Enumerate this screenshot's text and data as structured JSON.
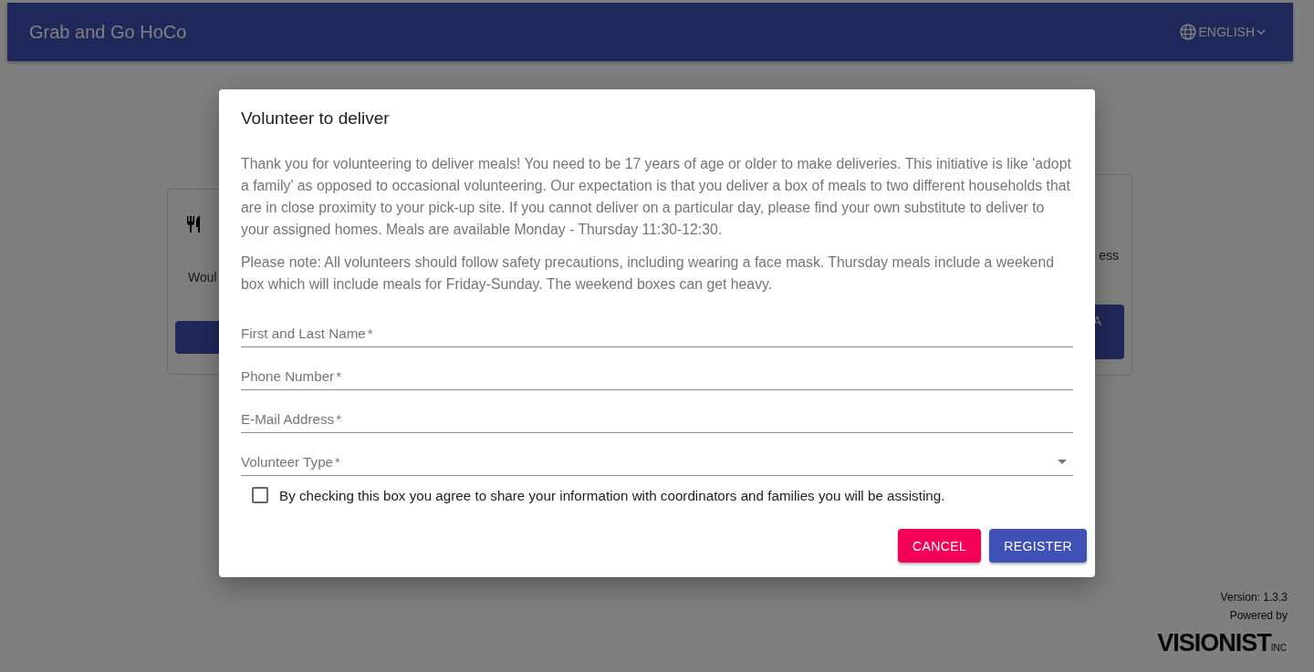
{
  "app_bar": {
    "title": "Grab and Go HoCo",
    "language": "ENGLISH"
  },
  "background": {
    "left_card": {
      "text": "Woul"
    },
    "right_card": {
      "text": "ess",
      "button": "A"
    }
  },
  "dialog": {
    "title": "Volunteer to deliver",
    "paragraphs": [
      "Thank you for volunteering to deliver meals! You need to be 17 years of age or older to make deliveries. This initiative is like 'adopt a family' as opposed to occasional volunteering. Our expectation is that you deliver a box of meals to two different households that are in close proximity to your pick-up site. If you cannot deliver on a particular day, please find your own substitute to deliver to your assigned homes. Meals are available Monday - Thursday 11:30-12:30.",
      "Please note: All volunteers should follow safety precautions, including wearing a face mask. Thursday meals include a weekend box which will include meals for Friday-Sunday. The weekend boxes can get heavy."
    ],
    "fields": [
      {
        "label": "First and Last Name",
        "required_mark": "*",
        "kind": "text"
      },
      {
        "label": "Phone Number",
        "required_mark": "*",
        "kind": "text"
      },
      {
        "label": "E-Mail Address",
        "required_mark": "*",
        "kind": "text"
      },
      {
        "label": "Volunteer Type",
        "required_mark": "*",
        "kind": "select"
      }
    ],
    "agreement": {
      "label": "By checking this box you agree to share your information with coordinators and families you will be assisting.",
      "checked": false
    },
    "buttons": [
      {
        "label": "CANCEL",
        "kind": "secondary"
      },
      {
        "label": "REGISTER",
        "kind": "primary"
      }
    ]
  },
  "footer": {
    "version": "Version: 1.3.3",
    "powered_by": "Powered by",
    "logo": "VISIONIST",
    "logo_suffix": "INC"
  }
}
